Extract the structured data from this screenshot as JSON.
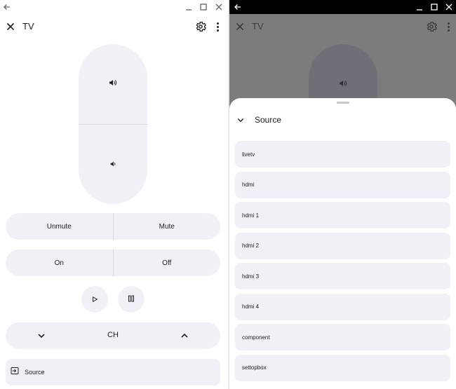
{
  "left": {
    "window": {
      "back_icon": "arrow-left-icon",
      "min_icon": "minimize-icon",
      "max_icon": "maximize-icon",
      "close_icon": "close-icon"
    },
    "appbar": {
      "title": "TV",
      "close_icon": "close-icon",
      "settings_icon": "gear-icon",
      "more_icon": "more-vert-icon"
    },
    "volume": {
      "up_icon": "volume-up-icon",
      "down_icon": "volume-down-icon"
    },
    "mute_row": {
      "unmute_label": "Unmute",
      "mute_label": "Mute"
    },
    "power_row": {
      "on_label": "On",
      "off_label": "Off"
    },
    "playback": {
      "play_icon": "play-icon",
      "pause_icon": "pause-icon"
    },
    "channel": {
      "label": "CH",
      "down_icon": "chevron-down-icon",
      "up_icon": "chevron-up-icon"
    },
    "source": {
      "label": "Source",
      "icon": "input-icon"
    }
  },
  "right": {
    "appbar": {
      "title": "TV"
    },
    "sheet": {
      "title": "Source",
      "collapse_icon": "chevron-down-icon",
      "items": [
        {
          "label": "livetv"
        },
        {
          "label": "hdmi"
        },
        {
          "label": "hdmi 1"
        },
        {
          "label": "hdmi 2"
        },
        {
          "label": "hdmi 3"
        },
        {
          "label": "hdmi 4"
        },
        {
          "label": "component"
        },
        {
          "label": "settopbox"
        }
      ]
    }
  },
  "colors": {
    "surface": "#f0f1f6",
    "scrim": "#7c7c7c",
    "text": "#202124",
    "chrome_dark": "#000000"
  }
}
